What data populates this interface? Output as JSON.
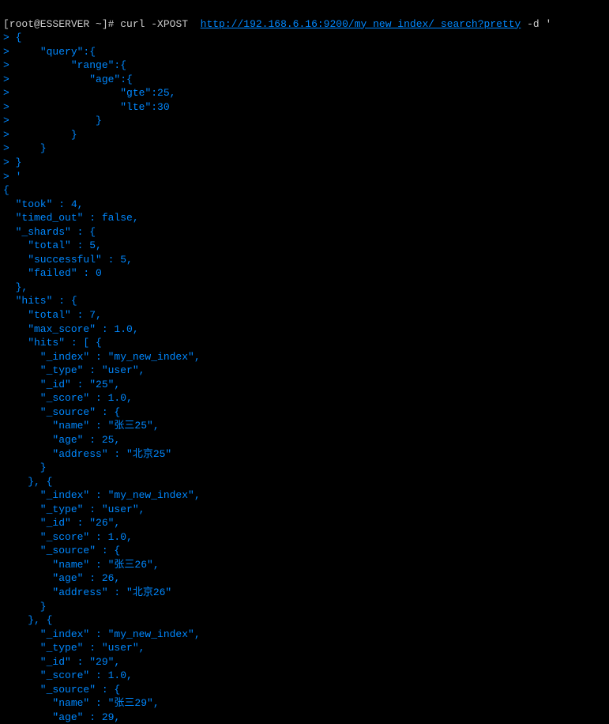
{
  "prompt": "[root@ESSERVER ~]# ",
  "command": "curl -XPOST  ",
  "url": "http://192.168.6.16:9200/my_new_index/_search?pretty",
  "flag": " -d ",
  "quote_open": "'",
  "continuation": ">",
  "request_body": {
    "line1": " {",
    "line2": "     \"query\":{",
    "line3": "          \"range\":{",
    "line4": "             \"age\":{",
    "line5": "                  \"gte\":25,",
    "line6": "                  \"lte\":30",
    "line7": "              }",
    "line8": "          }",
    "line9": "     }",
    "line10": " }",
    "line11": " '"
  },
  "response": {
    "open_brace": "{",
    "took_key": "  \"took\" : ",
    "took_val": "4,",
    "timed_out_key": "  \"timed_out\" : ",
    "timed_out_val": "false,",
    "shards_key": "  \"_shards\" : {",
    "shards_total": "    \"total\" : 5,",
    "shards_successful": "    \"successful\" : 5,",
    "shards_failed": "    \"failed\" : 0",
    "shards_close": "  },",
    "hits_key": "  \"hits\" : {",
    "hits_total": "    \"total\" : 7,",
    "hits_max_score": "    \"max_score\" : 1.0,",
    "hits_array": "    \"hits\" : [ {",
    "hit1_index": "      \"_index\" : \"my_new_index\",",
    "hit1_type": "      \"_type\" : \"user\",",
    "hit1_id": "      \"_id\" : \"25\",",
    "hit1_score": "      \"_score\" : 1.0,",
    "hit1_source": "      \"_source\" : {",
    "hit1_name": "        \"name\" : \"张三25\",",
    "hit1_age": "        \"age\" : 25,",
    "hit1_address": "        \"address\" : \"北京25\"",
    "hit1_source_close": "      }",
    "hit1_close": "    }, {",
    "hit2_index": "      \"_index\" : \"my_new_index\",",
    "hit2_type": "      \"_type\" : \"user\",",
    "hit2_id": "      \"_id\" : \"26\",",
    "hit2_score": "      \"_score\" : 1.0,",
    "hit2_source": "      \"_source\" : {",
    "hit2_name": "        \"name\" : \"张三26\",",
    "hit2_age": "        \"age\" : 26,",
    "hit2_address": "        \"address\" : \"北京26\"",
    "hit2_source_close": "      }",
    "hit2_close": "    }, {",
    "hit3_index": "      \"_index\" : \"my_new_index\",",
    "hit3_type": "      \"_type\" : \"user\",",
    "hit3_id": "      \"_id\" : \"29\",",
    "hit3_score": "      \"_score\" : 1.0,",
    "hit3_source": "      \"_source\" : {",
    "hit3_name": "        \"name\" : \"张三29\",",
    "hit3_age": "        \"age\" : 29,"
  }
}
